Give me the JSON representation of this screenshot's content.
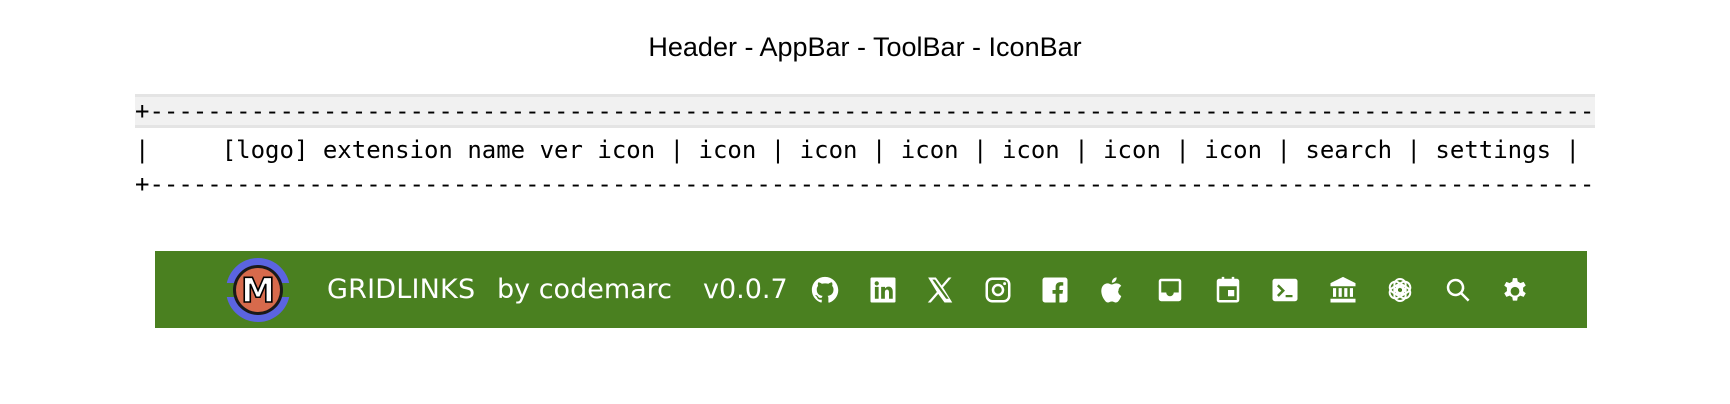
{
  "page": {
    "title": "Header - AppBar - ToolBar - IconBar"
  },
  "ascii_diagram": {
    "border_top": "+--------------------------------------------------------------------------------------------------------+",
    "content": "|     [logo] extension name ver icon | icon | icon | icon | icon | icon | icon | search | settings |",
    "border_bottom": "+--------------------------------------------------------------------------------------------------------+"
  },
  "appbar": {
    "background": "#4a8020",
    "brand": "GRIDLINKS",
    "author": "by codemarc",
    "version": "v0.0.7",
    "logo_letter": "M",
    "icons": [
      "github-icon",
      "linkedin-icon",
      "x-icon",
      "instagram-icon",
      "facebook-icon",
      "apple-icon",
      "inbox-icon",
      "calendar-icon",
      "terminal-icon",
      "bank-icon",
      "openai-icon",
      "search-icon",
      "settings-icon"
    ]
  }
}
